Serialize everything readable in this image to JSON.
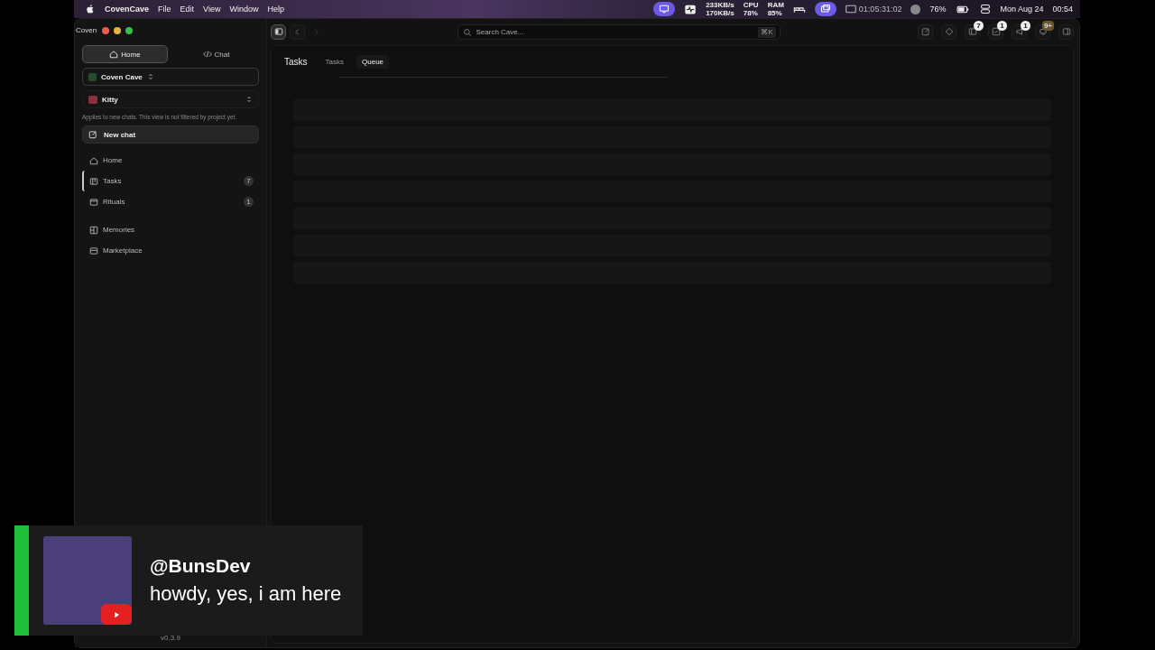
{
  "menubar": {
    "app_name": "CovenCave",
    "menus": [
      "File",
      "Edit",
      "View",
      "Window",
      "Help"
    ],
    "network": {
      "up": "233KB/s",
      "down": "170KB/s"
    },
    "cpu": {
      "label": "CPU",
      "value": "78%"
    },
    "ram": {
      "label": "RAM",
      "value": "85%"
    },
    "timer": "01:05:31:02",
    "battery": "76%",
    "date": "Mon Aug 24",
    "time": "00:54"
  },
  "window": {
    "title": "Coven"
  },
  "toolbar": {
    "search": {
      "placeholder": "Search Cave...",
      "shortcut": "⌘K"
    },
    "badges": [
      "7",
      "1",
      "1",
      "9+"
    ]
  },
  "sidebar": {
    "modes": [
      {
        "label": "Home",
        "selected": true
      },
      {
        "label": "Chat",
        "selected": false
      }
    ],
    "project": "Coven Cave",
    "agent": "Kitty",
    "hint": "Applies to new chats. This view is not filtered by project yet.",
    "new_chat": "New chat",
    "items": [
      {
        "label": "Home",
        "selected": false
      },
      {
        "label": "Tasks",
        "selected": true,
        "count": "7"
      },
      {
        "label": "Rituals",
        "selected": false,
        "count": "1"
      },
      {
        "label": "Memories",
        "selected": false
      },
      {
        "label": "Marketplace",
        "selected": false
      }
    ],
    "version": "v0.3.9"
  },
  "main": {
    "title": "Tasks",
    "tabs": [
      {
        "label": "Tasks",
        "selected": false
      },
      {
        "label": "Queue",
        "selected": true
      }
    ]
  },
  "notification": {
    "user": "@BunsDev",
    "message": "howdy, yes, i am here"
  }
}
